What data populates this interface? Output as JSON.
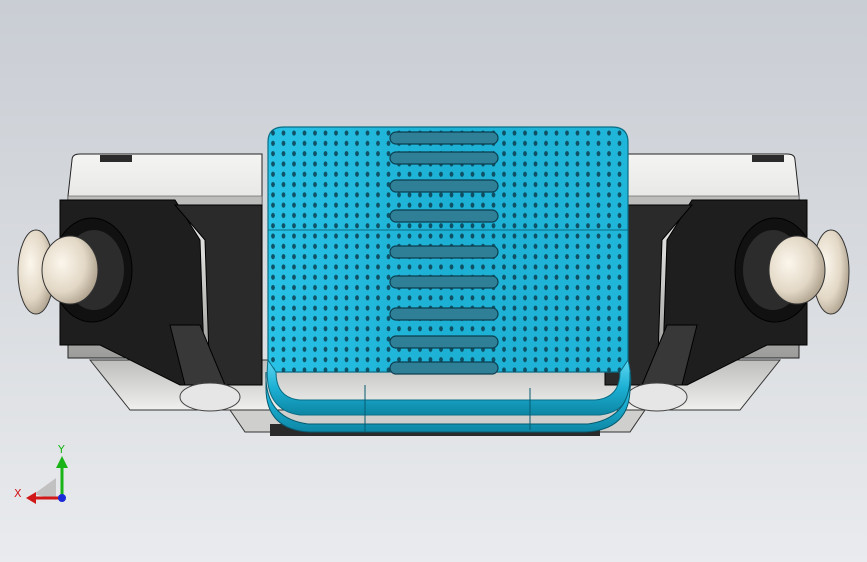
{
  "viewport": {
    "background_top": "#c9cdd4",
    "background_bottom": "#e9ebee"
  },
  "model": {
    "seat_color": "#1cb0d4",
    "seat_edge_color": "#0a6e86",
    "slot_color": "#2f7f96",
    "housing_color": "#dcdcda",
    "frame_color": "#1f1f1f",
    "knob_color": "#e8dfd0"
  },
  "triad": {
    "x_label": "X",
    "y_label": "Y",
    "x_color": "#d01818",
    "y_color": "#18b418",
    "z_color": "#1a2ad8"
  }
}
